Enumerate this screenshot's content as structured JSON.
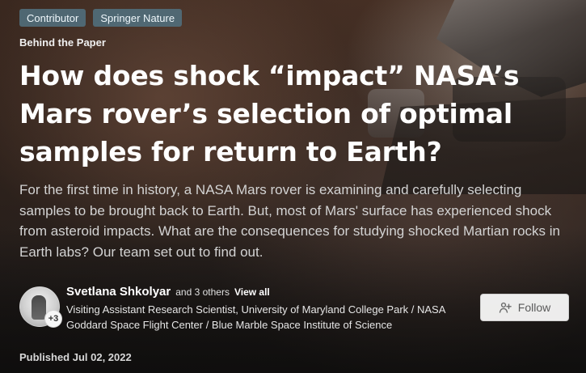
{
  "tags": [
    {
      "label": "Contributor"
    },
    {
      "label": "Springer Nature"
    }
  ],
  "kicker": "Behind the Paper",
  "title": "How does shock “impact” NASA’s Mars rover’s selection of optimal samples for return to Earth?",
  "abstract": "For the first time in history, a NASA Mars rover is examining and carefully selecting samples to be brought back to Earth. But, most of Mars' surface has experienced shock from asteroid impacts. What are the consequences for studying shocked Martian rocks in Earth labs? Our team set out to find out.",
  "author": {
    "name": "Svetlana Shkolyar",
    "extra": "and 3 others",
    "view_all": "View all",
    "avatar_badge": "+3",
    "affiliation": "Visiting Assistant Research Scientist, University of Maryland College Park / NASA Goddard Space Flight Center / Blue Marble Space Institute of Science"
  },
  "follow": {
    "label": "Follow",
    "icon": "add-user-icon"
  },
  "published": "Published Jul 02, 2022",
  "colors": {
    "tag_bg": "#506C7A",
    "follow_bg": "#FFFFFF",
    "text_primary": "#FFFFFF",
    "text_secondary": "#D3D3D3"
  }
}
